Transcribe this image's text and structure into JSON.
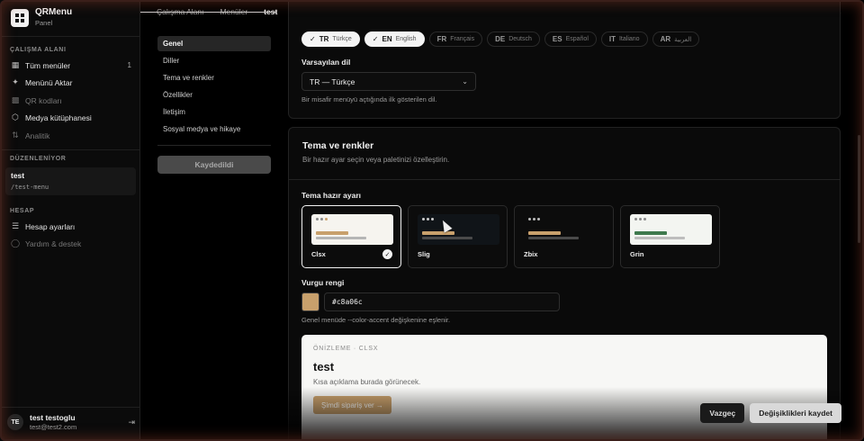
{
  "app": {
    "name": "QRMenu",
    "subtitle": "Panel"
  },
  "sidebar": {
    "workspace_label": "ÇALIŞMA ALANI",
    "workspace_items": [
      {
        "label": "Tüm menüler",
        "icon": "grid-icon",
        "count": "1"
      },
      {
        "label": "Menünü Aktar",
        "icon": "sparkle-icon"
      },
      {
        "label": "QR kodları",
        "icon": "qr-icon"
      },
      {
        "label": "Medya kütüphanesi",
        "icon": "box-icon"
      },
      {
        "label": "Analitik",
        "icon": "chart-icon"
      }
    ],
    "editing_label": "DÜZENLENİYOR",
    "editing": {
      "name": "test",
      "path": "/test-menu"
    },
    "account_label": "HESAP",
    "account_items": [
      {
        "label": "Hesap ayarları",
        "icon": "settings-icon"
      },
      {
        "label": "Yardım & destek",
        "icon": "help-icon"
      }
    ],
    "user": {
      "initials": "TE",
      "name": "test testoglu",
      "email": "test@test2.com"
    }
  },
  "breadcrumb": {
    "items": [
      "Çalışma Alanı",
      "Menüler",
      "test"
    ]
  },
  "settings_nav": {
    "items": [
      "Genel",
      "Diller",
      "Tema ve renkler",
      "Özellikler",
      "İletişim",
      "Sosyal medya ve hikaye"
    ],
    "save_label": "Kaydedildi"
  },
  "languages": {
    "chips": [
      {
        "code": "TR",
        "name": "Türkçe",
        "enabled": true
      },
      {
        "code": "EN",
        "name": "English",
        "enabled": true
      },
      {
        "code": "FR",
        "name": "Français",
        "enabled": false
      },
      {
        "code": "DE",
        "name": "Deutsch",
        "enabled": false
      },
      {
        "code": "ES",
        "name": "Español",
        "enabled": false
      },
      {
        "code": "IT",
        "name": "Italiano",
        "enabled": false
      },
      {
        "code": "AR",
        "name": "العربية",
        "enabled": false
      }
    ],
    "default_label": "Varsayılan dil",
    "default_value": "TR — Türkçe",
    "default_hint": "Bir misafir menüyü açtığında ilk gösterilen dil."
  },
  "theme": {
    "title": "Tema ve renkler",
    "subtitle": "Bir hazır ayar seçin veya paletinizi özelleştirin.",
    "preset_label": "Tema hazır ayarı",
    "presets": [
      {
        "name": "Clsx",
        "selected": true,
        "bg": "#f6f4ef",
        "dot": "#888888",
        "accent": "#c8a06c",
        "bar": "#b5b5b5"
      },
      {
        "name": "Slig",
        "selected": false,
        "bg": "#101418",
        "dot": "#cccccc",
        "accent": "#c8a06c",
        "bar": "#4a4a4a"
      },
      {
        "name": "Zbix",
        "selected": false,
        "bg": "#0c0c0c",
        "dot": "#bbbbbb",
        "accent": "#c8a06c",
        "bar": "#4a4a4a"
      },
      {
        "name": "Grin",
        "selected": false,
        "bg": "#f3f5f1",
        "dot": "#888888",
        "accent": "#3f7a4e",
        "bar": "#bdbdbd"
      }
    ],
    "accent_label": "Vurgu rengi",
    "accent_value": "#c8a06c",
    "accent_hint": "Genel menüde --color-accent değişkenine eşlenir.",
    "preview": {
      "tag": "ÖNİZLEME · CLSX",
      "title": "test",
      "description": "Kısa açıklama burada görünecek.",
      "cta": "Şimdi sipariş ver →"
    }
  },
  "actions": {
    "cancel": "Vazgeç",
    "save": "Değişiklikleri kaydet"
  }
}
